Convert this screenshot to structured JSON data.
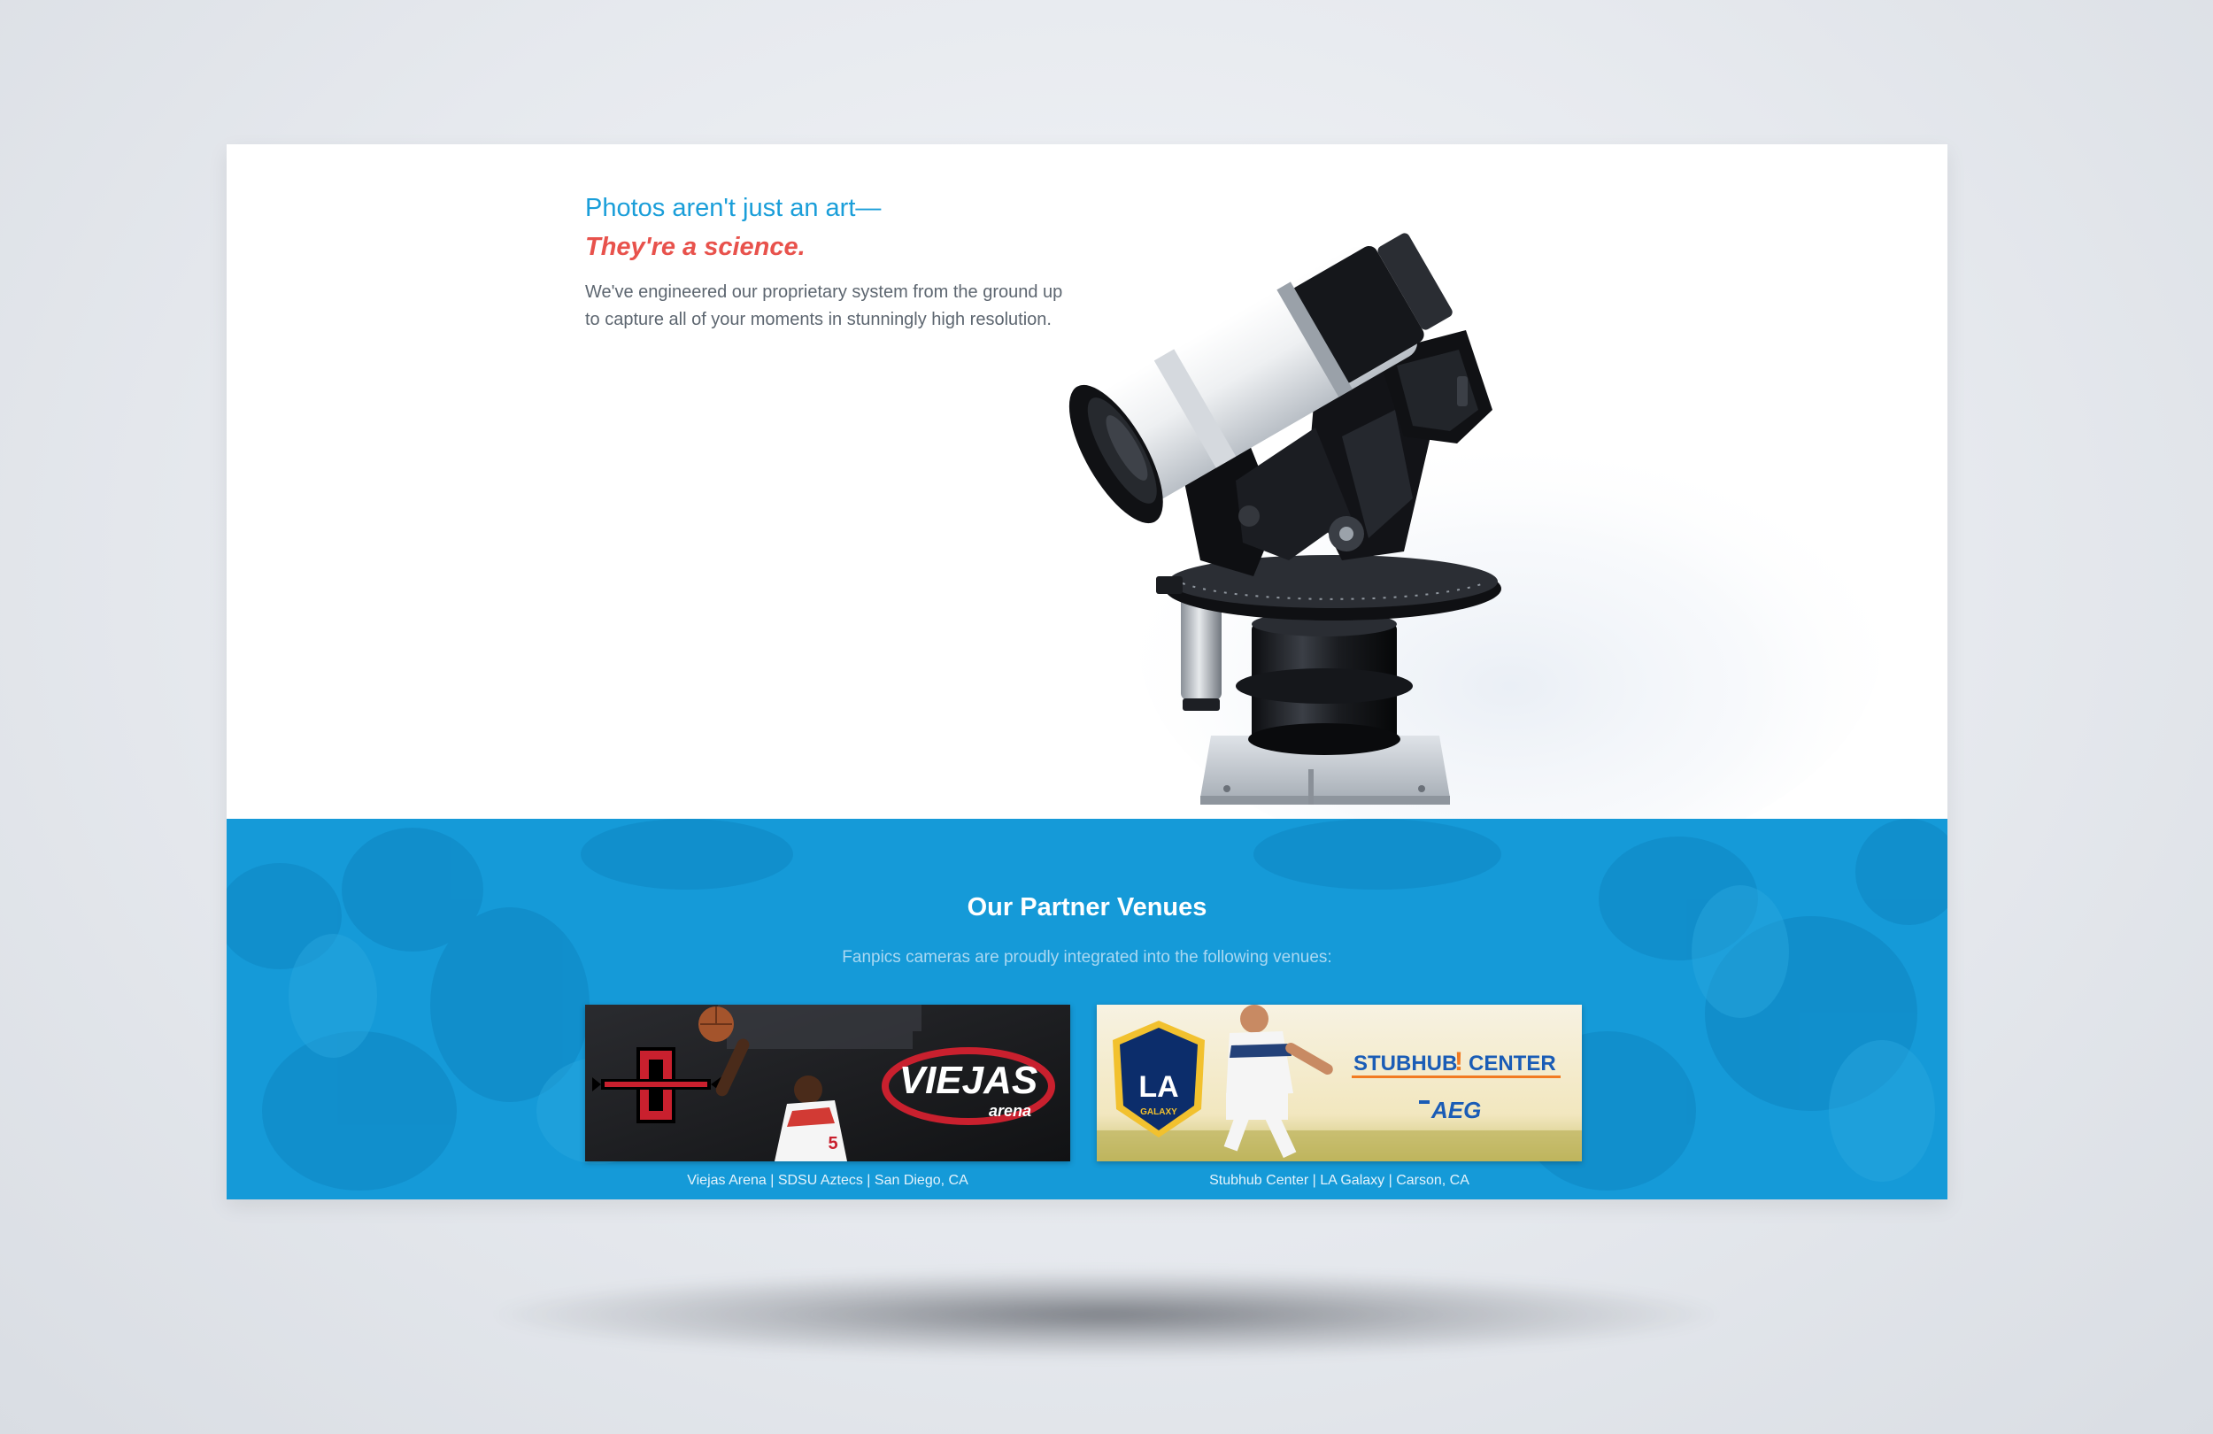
{
  "hero": {
    "title": "Photos aren't just an art—",
    "subtitle": "They're a science.",
    "body": "We've engineered our proprietary system from the ground up to capture all of your moments in stunningly high resolution."
  },
  "partners": {
    "title": "Our Partner Venues",
    "intro": "Fanpics cameras are proudly integrated into the following venues:",
    "venues": [
      {
        "caption": "Viejas Arena | SDSU Aztecs | San Diego, CA",
        "logo_text": "VIEJAS",
        "logo_sub": "arena",
        "player_number": "5"
      },
      {
        "caption": "Stubhub Center | LA Galaxy | Carson, CA",
        "crest_text": "LA",
        "crest_sub": "GALAXY",
        "brand_left": "STUBHUB",
        "brand_right": "CENTER",
        "brand_mark": "!",
        "sponsor": "AEG"
      }
    ]
  },
  "colors": {
    "accent_blue": "#1a9ed9",
    "accent_red": "#e8524c",
    "section_blue": "#159ad8"
  }
}
